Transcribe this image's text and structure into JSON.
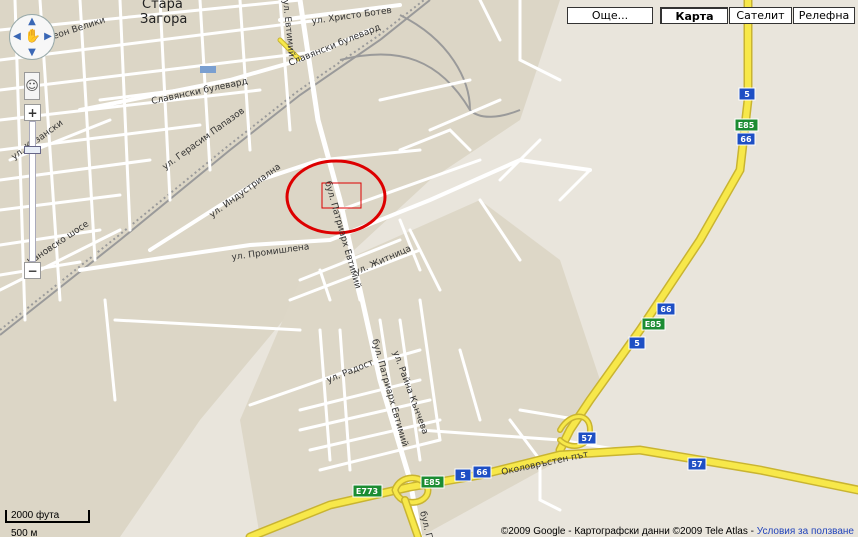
{
  "map_types": {
    "more": "Още...",
    "map": "Карта",
    "satellite": "Сателит",
    "terrain": "Релефна"
  },
  "city_label": [
    "Стара",
    "Загора"
  ],
  "street_labels": {
    "hristo_botev": "ул. Христо Ботев",
    "slavyanski_1": "Славянски булевард",
    "slavyanski_2": "Славянски булевард",
    "simeon": "ул. Симеон Велики",
    "gerasim": "ул. Герасим Папазов",
    "industrialna": "ул. Индустриална",
    "kazanski": "ул. Казански",
    "tzanovsko": "Чановско шосе",
    "promishlena": "ул. Промишлена",
    "patriarh_1": "бул. Патриарх Евтимий",
    "patriarh_2": "бул. Патриарх Евтимий",
    "zhitnitsa": "ул. Житница",
    "radost": "ул. Радост",
    "raina": "ул. Райна Кънчева",
    "okolovrasten": "Околовръстен път",
    "bul_bottom": "бул. П",
    "top_cut": "ул. Евтимий"
  },
  "route_shields": {
    "r5_top": "5",
    "e85_top": "E85",
    "r66_top": "66",
    "r66_mid": "66",
    "e85_mid": "E85",
    "r5_mid": "5",
    "r57_a": "57",
    "r57_b": "57",
    "e773": "E773",
    "e85_bottom": "E85",
    "r5_bottom": "5",
    "r66_bottom": "66"
  },
  "scale": {
    "feet": "2000 фута",
    "meters": "500 м"
  },
  "copyright": "©2009 Google - Картографски данни ©2009 Tele Atlas - ",
  "terms_link": "Условия за ползване",
  "colors": {
    "background": "#e9e5dc",
    "street": "#ffffff",
    "highway": "#f7e84a",
    "highway_border": "#c9b431",
    "marker": "#dd0000",
    "rail": "#9a9a9a",
    "green_shield": "#1b8c32",
    "blue_shield": "#1e4fc4"
  }
}
